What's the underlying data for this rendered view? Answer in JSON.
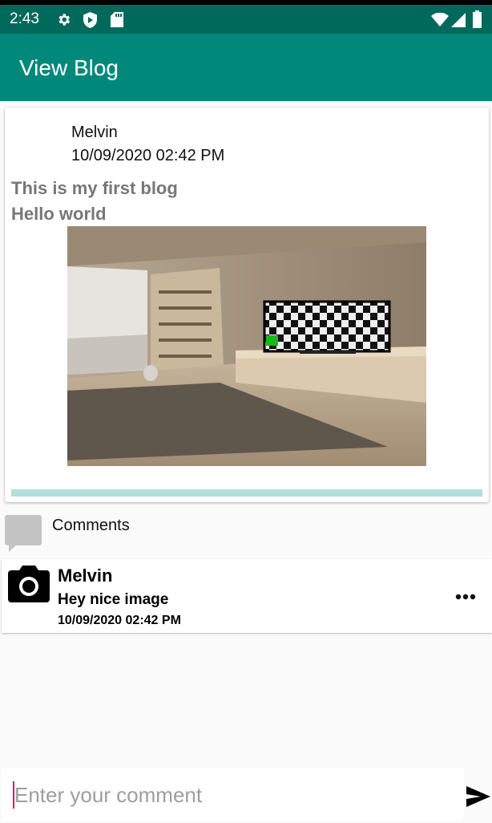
{
  "status_bar": {
    "time": "2:43",
    "icons": [
      "gear-icon",
      "shield-icon",
      "sd-card-icon",
      "wifi-icon",
      "signal-icon",
      "battery-icon"
    ]
  },
  "app_bar": {
    "title": "View Blog"
  },
  "post": {
    "author": "Melvin",
    "date": "10/09/2020 02:42 PM",
    "title": "This is my first blog",
    "body": "Hello world"
  },
  "comments": {
    "label": "Comments",
    "items": [
      {
        "author": "Melvin",
        "text": "Hey nice image",
        "date": "10/09/2020 02:42 PM"
      }
    ]
  },
  "input": {
    "placeholder": "Enter your comment",
    "value": ""
  },
  "colors": {
    "status_bar": "#00695c",
    "app_bar": "#00897b",
    "progress": "#b2dfdb",
    "cursor": "#d81b60"
  }
}
